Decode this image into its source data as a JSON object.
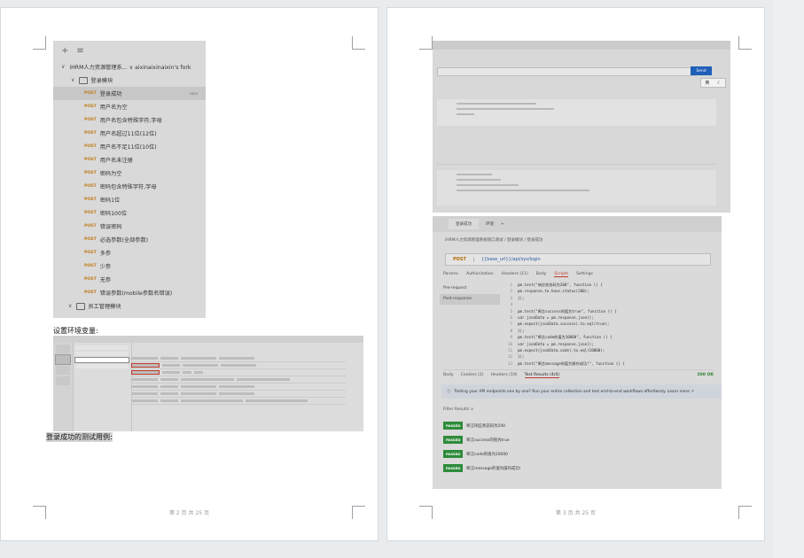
{
  "page1": {
    "tree": {
      "collection": "iHRM人力资源管理系...  ∨ aixinaixinaixin's fork",
      "folder1": "登录模块",
      "folder2": "员工管理模块",
      "method": "POST",
      "selected_tag": "save",
      "requests": [
        "登录成功",
        "用户名为空",
        "用户名包含特殊字符,字母",
        "用户名超过11位(12位)",
        "用户名不足11位(10位)",
        "用户名未注册",
        "密码为空",
        "密码包含特殊字符,字母",
        "密码1位",
        "密码100位",
        "错误密码",
        "必选参数(全部参数)",
        "多参",
        "少参",
        "无参",
        "错误参数(mobile参数名错误)"
      ]
    },
    "caption_env": "设置环境变量:",
    "caption_login": "登录成功的测试用例:",
    "footer": "第 2 页 共 25 页"
  },
  "page2": {
    "shotB": {
      "tab_title": "登录成功",
      "tab_env": "环境",
      "breadcrumb": "iHRM人力资源管理系统接口测试 / 登录模块 / 登录成功",
      "method": "POST",
      "url": "{{base_url}}/api/sys/login",
      "subtabs": [
        "Params",
        "Authorization",
        "Headers (11)",
        "Body",
        "Scripts",
        "Settings"
      ],
      "left_items": [
        "Pre-request",
        "Post-response"
      ],
      "code": [
        [
          "1",
          "pm.test(\"响应状态码为200\", function () {"
        ],
        [
          "2",
          "    pm.response.to.have.status(200);"
        ],
        [
          "3",
          "});"
        ],
        [
          "4",
          ""
        ],
        [
          "5",
          "pm.test(\"断言success的值为true\", function () {"
        ],
        [
          "6",
          "    var jsonData = pm.response.json();"
        ],
        [
          "7",
          "    pm.expect(jsonData.success).to.eql(true);"
        ],
        [
          "8",
          "});"
        ],
        [
          "9",
          "pm.test(\"断言code的值为10000\", function () {"
        ],
        [
          "10",
          "    var jsonData = pm.response.json();"
        ],
        [
          "11",
          "    pm.expect(jsonData.code).to.eql(10000);"
        ],
        [
          "12",
          "});"
        ],
        [
          "13",
          "pm.test(\"断言message的值为操作成功!\", function () {"
        ]
      ],
      "resp_tabs": [
        "Body",
        "Cookies (2)",
        "Headers (19)",
        "Test Results (4/4)"
      ],
      "status": "200 OK",
      "banner": "Testing your API endpoints one by one? Run your entire collection and test end-to-end workflows effortlessly. Learn more ↗",
      "filter": "Filter Results ∨",
      "pass_label": "PASSED",
      "results": [
        "断言响应状态码为200",
        "断言success的值为true",
        "断言code的值为10000",
        "断言message的值为操作成功!"
      ]
    },
    "shotA": {
      "send": "Send",
      "ime": [
        "英"
      ]
    },
    "footer": "第 3 页 共 25 页"
  }
}
